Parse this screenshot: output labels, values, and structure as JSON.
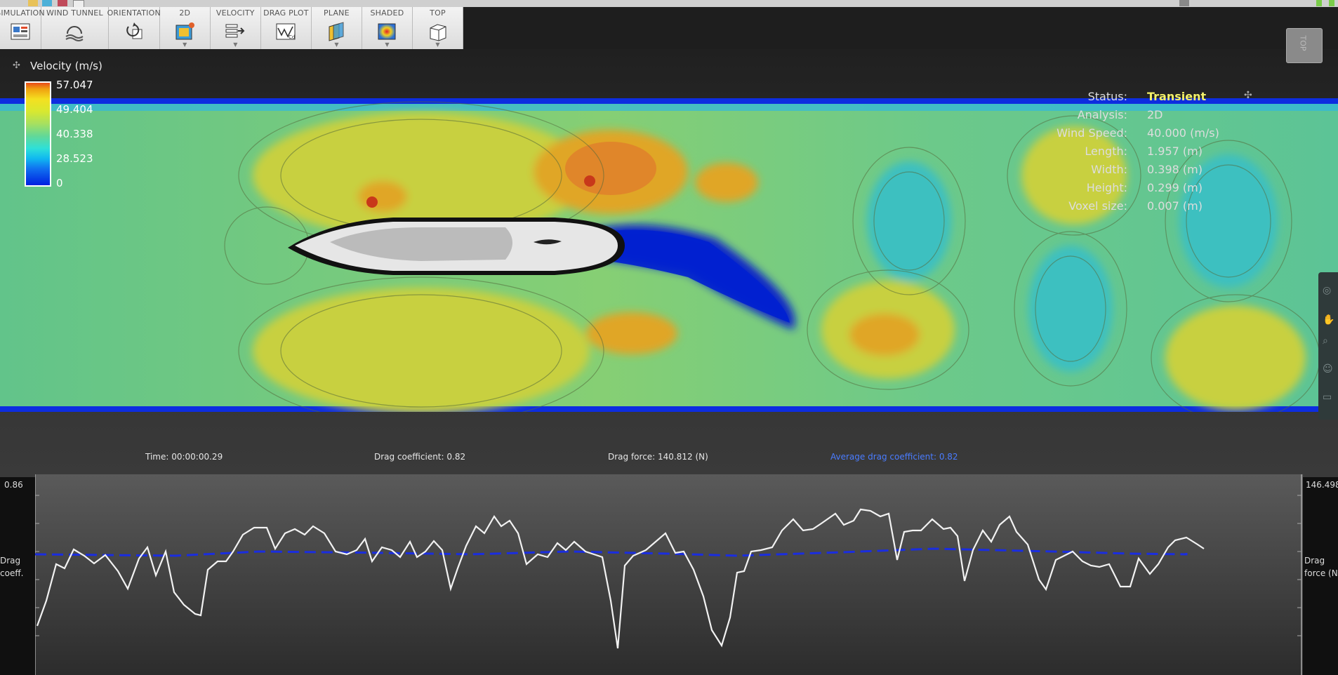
{
  "toolbar": {
    "groups": [
      {
        "label": "SIMULATION",
        "icon": "simulation-icon"
      },
      {
        "label": "WIND TUNNEL",
        "icon": "wind-tunnel-icon"
      },
      {
        "label": "ORIENTATION",
        "icon": "orientation-icon"
      },
      {
        "label": "2D",
        "icon": "2d-icon"
      },
      {
        "label": "VELOCITY",
        "icon": "velocity-icon"
      },
      {
        "label": "DRAG PLOT",
        "icon": "drag-plot-icon"
      },
      {
        "label": "PLANE",
        "icon": "plane-icon"
      },
      {
        "label": "SHADED",
        "icon": "shaded-icon"
      },
      {
        "label": "TOP",
        "icon": "top-view-icon"
      }
    ]
  },
  "viewcube": {
    "label": "TOP"
  },
  "legend": {
    "title": "Velocity (m/s)",
    "values": [
      "57.047",
      "49.404",
      "40.338",
      "28.523",
      "0"
    ]
  },
  "status": {
    "rows": [
      {
        "key": "Status:",
        "value": "Transient",
        "highlight": true
      },
      {
        "key": "Analysis:",
        "value": "2D"
      },
      {
        "key": "Wind Speed:",
        "value": "40.000 (m/s)"
      },
      {
        "key": "Length:",
        "value": "1.957 (m)"
      },
      {
        "key": "Width:",
        "value": "0.398 (m)"
      },
      {
        "key": "Height:",
        "value": "0.299 (m)"
      },
      {
        "key": "Voxel size:",
        "value": "0.007 (m)"
      }
    ],
    "highlight_color": "#f2f06a"
  },
  "footer": {
    "time": "Time: 00:00:00.29",
    "drag_coefficient": "Drag coefficient: 0.82",
    "drag_force": "Drag force: 140.812 (N)",
    "average_drag_coefficient": "Average drag coefficient: 0.82"
  },
  "plot": {
    "left_top_value": "0.86",
    "right_top_value": "146.498",
    "left_axis_label_1": "Drag",
    "left_axis_label_2": "coeff.",
    "right_axis_label_1": "Drag",
    "right_axis_label_2": "force (N",
    "drag_force_series_color": "#ffffff",
    "average_series_color": "#1a2de0"
  },
  "colors": {
    "field_low": "#0010c8",
    "field_mid": "#5fc98a",
    "field_high": "#e87a18"
  }
}
